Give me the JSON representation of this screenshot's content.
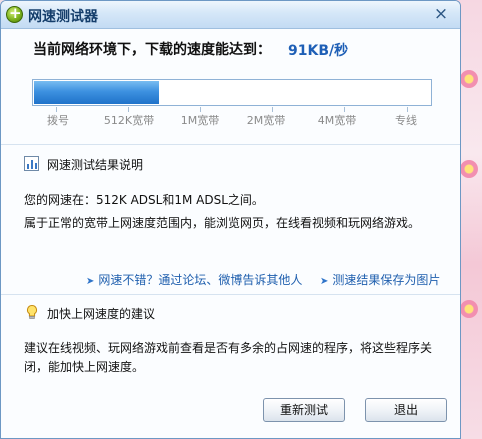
{
  "window": {
    "title": "网速测试器",
    "close_label": "×"
  },
  "result": {
    "headline": "当前网络环境下，下载的速度能达到：",
    "speed": "91KB/秒",
    "progress_fraction": 0.315,
    "scale_labels": [
      "拨号",
      "512K宽带",
      "1M宽带",
      "2M宽带",
      "4M宽带",
      "专线"
    ]
  },
  "explanation": {
    "title": "网速测试结果说明",
    "line1": "您的网速在：512K ADSL和1M ADSL之间。",
    "line2": "属于正常的宽带上网速度范围内，能浏览网页，在线看视频和玩网络游戏。"
  },
  "links": {
    "share": "网速不错？通过论坛、微博告诉其他人",
    "save_image": "测速结果保存为图片"
  },
  "advice": {
    "title": "加快上网速度的建议",
    "line1": "建议在线视频、玩网络游戏前查看是否有多余的占网速的程序，将这些程序关",
    "line2": "闭，能加快上网速度。"
  },
  "buttons": {
    "retest": "重新测试",
    "exit": "退出"
  }
}
